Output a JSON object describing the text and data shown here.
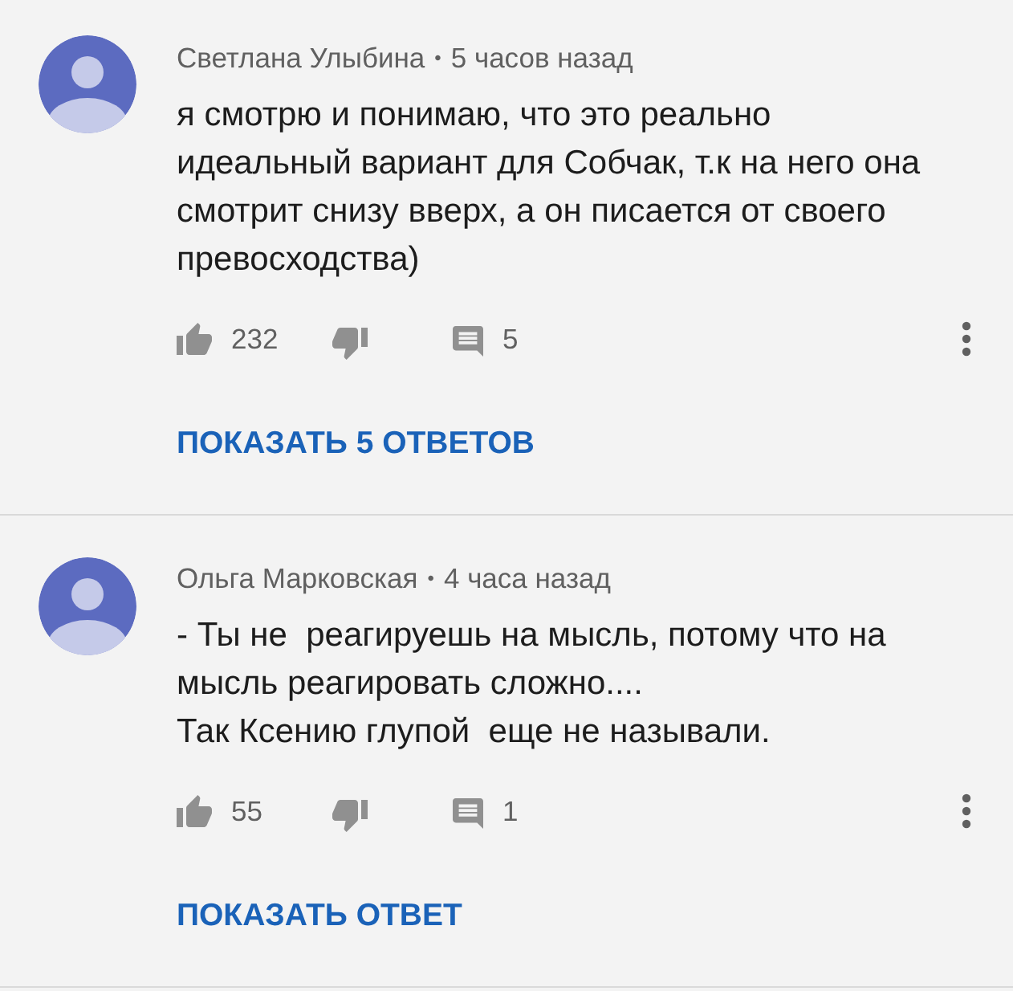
{
  "comments": [
    {
      "author": "Светлана Улыбина",
      "separator": "•",
      "time": "5 часов назад",
      "text": "я смотрю и понимаю, что это реально\nидеальный вариант для Собчак, т.к на него она\nсмотрит снизу вверх, а он писается от своего\nпревосходства)",
      "likes": "232",
      "replies": "5",
      "show_replies": "ПОКАЗАТЬ 5 ОТВЕТОВ"
    },
    {
      "author": "Ольга Марковская",
      "separator": "•",
      "time": "4 часа назад",
      "text": "- Ты не  реагируешь на мысль, потому что на\nмысль реагировать сложно....\nТак Ксению глупой  еще не называли.",
      "likes": "55",
      "replies": "1",
      "show_replies": "ПОКАЗАТЬ ОТВЕТ"
    }
  ]
}
